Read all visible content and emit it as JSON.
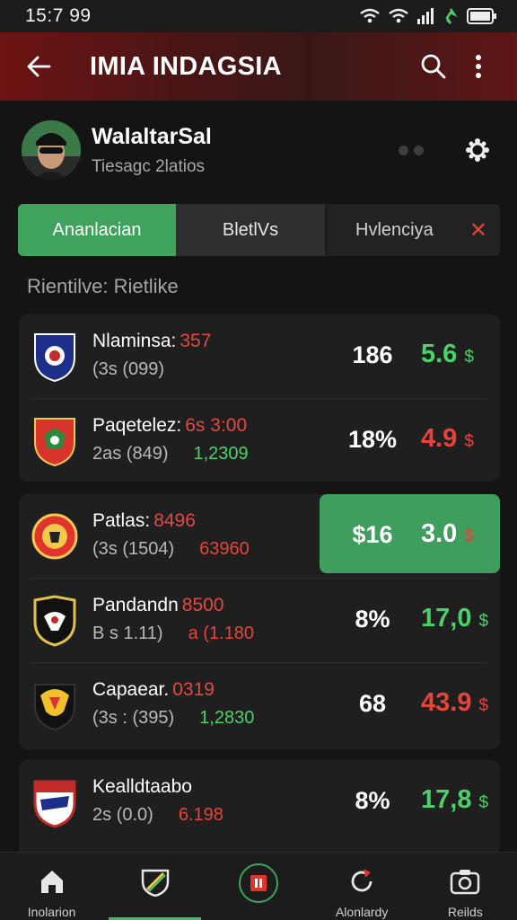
{
  "status": {
    "time": "15:7 99"
  },
  "header": {
    "title": "IMIA INDAGSIA"
  },
  "profile": {
    "name": "WalaltarSal",
    "subtitle": "Tiesagc 2latios"
  },
  "tabs": [
    {
      "label": "Ananlacian",
      "active": true
    },
    {
      "label": "BletlVs",
      "active": false
    },
    {
      "label": "Hvlenciya",
      "active": false
    }
  ],
  "section_label": "Rientilve: Rietlike",
  "rows": [
    {
      "name": "Nlaminsa:",
      "name_value": "357",
      "meta": "(3s (099)",
      "meta_value": "",
      "meta_color": "",
      "col1": "186",
      "col2": "5.6",
      "col2_suffix": "$",
      "col2_color": "green"
    },
    {
      "name": "Paqetelez:",
      "name_value": "6s 3:00",
      "meta": "2as (849)",
      "meta_value": "1,2309",
      "meta_color": "green",
      "col1": "18%",
      "col2": "4.9",
      "col2_suffix": "$",
      "col2_color": "red"
    },
    {
      "name": "Patlas:",
      "name_value": "8496",
      "meta": "(3s (1504)",
      "meta_value": "63960",
      "meta_color": "red",
      "col1": "$16",
      "col2": "3.0",
      "col2_suffix": "$",
      "col2_color": "white",
      "highlighted": true
    },
    {
      "name": "Pandandn",
      "name_value": "8500",
      "meta": "B s 1.11)",
      "meta_value": "a (1.180",
      "meta_color": "red",
      "col1": "8%",
      "col2": "17,0",
      "col2_suffix": "$",
      "col2_color": "green"
    },
    {
      "name": "Capaear.",
      "name_value": "0319",
      "meta": "(3s : (395)",
      "meta_value": "1,2830",
      "meta_color": "green",
      "col1": "68",
      "col2": "43.9",
      "col2_suffix": "$",
      "col2_color": "red"
    },
    {
      "name": "Kealldtaabo",
      "name_value": "",
      "meta": "2s (0.0)",
      "meta_value": "6.198",
      "meta_color": "red",
      "col1": "8%",
      "col2": "17,8",
      "col2_suffix": "$",
      "col2_color": "green"
    }
  ],
  "nav": [
    {
      "label": "Inolarion",
      "icon": "home-icon"
    },
    {
      "label": "",
      "icon": "shield-icon",
      "active": true
    },
    {
      "label": "",
      "icon": "trophy-icon"
    },
    {
      "label": "Alonlardy",
      "icon": "refresh-icon"
    },
    {
      "label": "Reilds",
      "icon": "camera-icon"
    }
  ]
}
